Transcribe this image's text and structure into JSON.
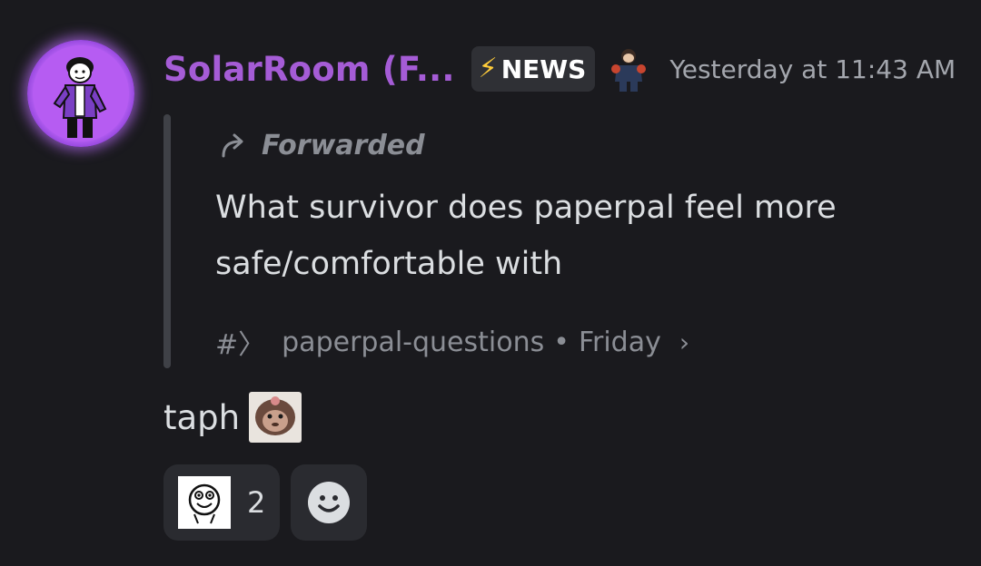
{
  "message": {
    "username": "SolarRoom (F...",
    "tag": {
      "icon": "lightning-bolt-icon",
      "label": "NEWS"
    },
    "role_badge_icon": "character-badge-icon",
    "timestamp": "Yesterday at 11:43 AM",
    "forwarded": {
      "label": "Forwarded",
      "text": "What survivor does paperpal feel more safe/comfortable with",
      "channel_icon": "#〉",
      "channel": "paperpal-questions",
      "separator": "•",
      "date": "Friday",
      "chevron": "›"
    },
    "reply_text": "taph",
    "reply_emoji_icon": "monkey-emoji-icon",
    "reactions": [
      {
        "icon": "smiley-face-icon",
        "count": "2"
      }
    ],
    "add_reaction_icon": "add-reaction-icon"
  },
  "colors": {
    "background": "#1a1a1e",
    "username": "#a55cd6",
    "tag_bg": "#2f3035",
    "bolt": "#ffcc3a",
    "muted": "#8b8e95",
    "text": "#dbdee1",
    "avatar_glow": "#c86dff"
  }
}
